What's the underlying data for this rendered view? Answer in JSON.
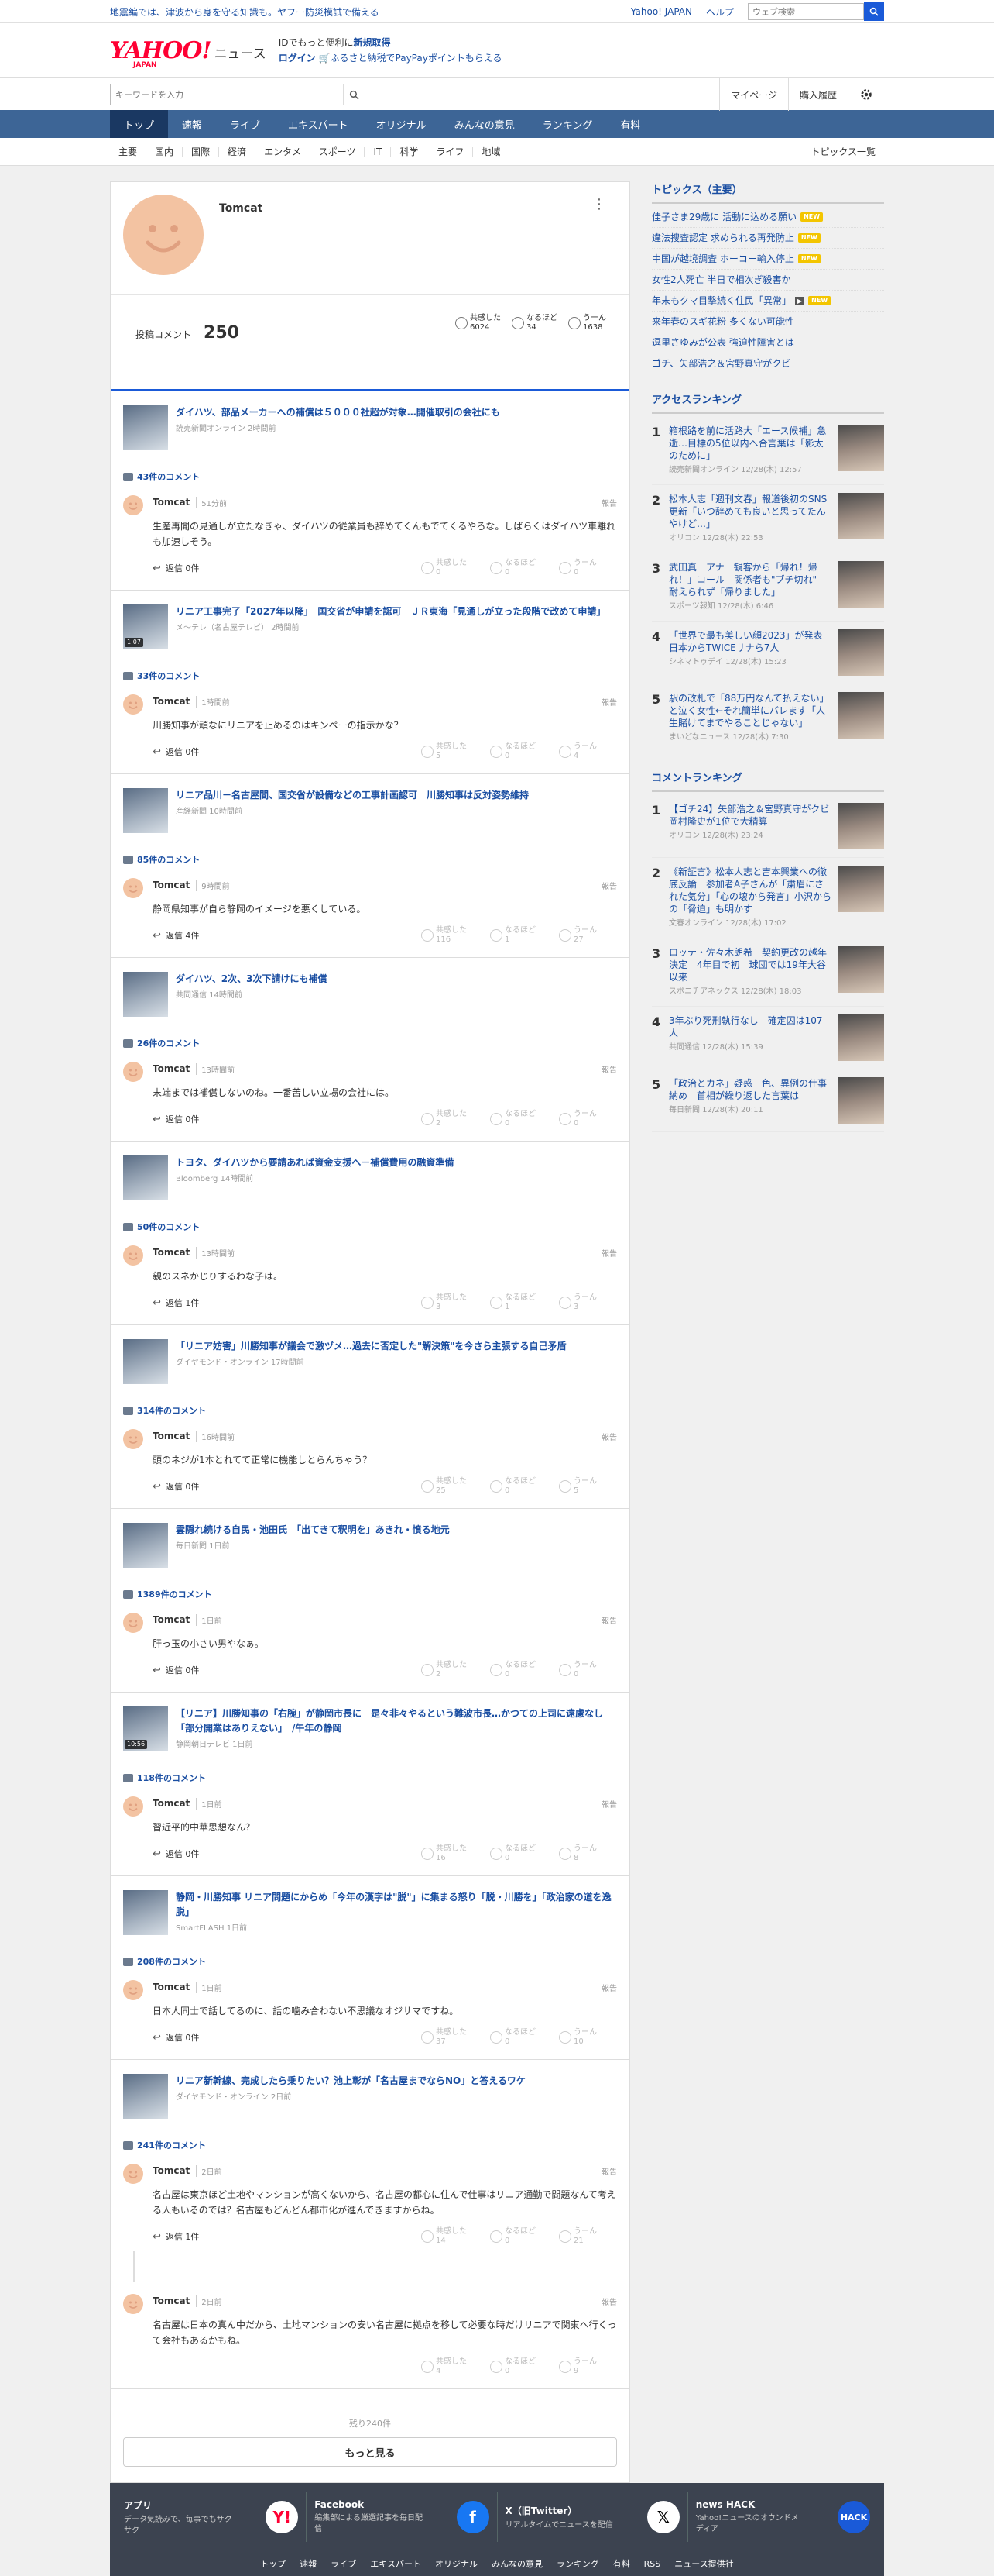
{
  "topbar": {
    "notice": "地震編では、津波から身を守る知識も。ヤフー防災模試で備える",
    "links": [
      "Yahoo! JAPAN",
      "ヘルプ"
    ],
    "search_placeholder": "ウェブ検索"
  },
  "header": {
    "logo": "YAHOO!",
    "logo_sub": "JAPAN",
    "logo_news": "ニュース",
    "line1_prefix": "IDでもっと便利に",
    "line1_link": "新規取得",
    "login": "ログイン",
    "line2": "ふるさと納税でPayPayポイントもらえる"
  },
  "searchbar": {
    "placeholder": "キーワードを入力",
    "mypage": "マイページ",
    "history": "購入履歴"
  },
  "nav": [
    "トップ",
    "速報",
    "ライブ",
    "エキスパート",
    "オリジナル",
    "みんなの意見",
    "ランキング",
    "有料"
  ],
  "subnav": [
    "主要",
    "国内",
    "国際",
    "経済",
    "エンタメ",
    "スポーツ",
    "IT",
    "科学",
    "ライフ",
    "地域"
  ],
  "subnav_more": "トピックス一覧",
  "profile": {
    "name": "Tomcat",
    "posts_label": "投稿コメント",
    "posts": "250",
    "stats": [
      {
        "label": "共感した",
        "value": "6024"
      },
      {
        "label": "なるほど",
        "value": "34"
      },
      {
        "label": "うーん",
        "value": "1638"
      }
    ]
  },
  "items": [
    {
      "title": "ダイハツ、部品メーカーへの補償は５０００社超が対象…開催取引の会社にも",
      "src": "読売新聞オンライン 2時間前",
      "count": "43件のコメント",
      "comments": [
        {
          "user": "Tomcat",
          "time": "51分前",
          "text": "生産再開の見通しが立たなきゃ、ダイハツの従業員も辞めてくんもでてくるやろな。しばらくはダイハツ車離れも加速しそう。",
          "reply": "返信 0件",
          "r": [
            "0",
            "0",
            "0"
          ]
        }
      ]
    },
    {
      "title": "リニア工事完了「2027年以降」　国交省が申請を認可　ＪＲ東海「見通しが立った段階で改めて申請」",
      "src": "メ〜テレ（名古屋テレビ） 2時間前",
      "video": "1:07",
      "count": "33件のコメント",
      "comments": [
        {
          "user": "Tomcat",
          "time": "1時間前",
          "text": "川勝知事が頑なにリニアを止めるのはキンペーの指示かな？",
          "reply": "返信 0件",
          "r": [
            "5",
            "0",
            "4"
          ]
        }
      ]
    },
    {
      "title": "リニア品川－名古屋間、国交省が設備などの工事計画認可　川勝知事は反対姿勢維持",
      "src": "産経新聞 10時間前",
      "count": "85件のコメント",
      "comments": [
        {
          "user": "Tomcat",
          "time": "9時間前",
          "text": "静岡県知事が自ら静岡のイメージを悪くしている。",
          "reply": "返信 4件",
          "r": [
            "116",
            "1",
            "27"
          ]
        }
      ]
    },
    {
      "title": "ダイハツ、2次、3次下請けにも補償",
      "src": "共同通信 14時間前",
      "count": "26件のコメント",
      "comments": [
        {
          "user": "Tomcat",
          "time": "13時間前",
          "text": "末端までは補償しないのね。一番苦しい立場の会社には。",
          "reply": "返信 0件",
          "r": [
            "2",
            "0",
            "0"
          ]
        }
      ]
    },
    {
      "title": "トヨタ、ダイハツから要請あれば資金支援へ－補償費用の融資準備",
      "src": "Bloomberg 14時間前",
      "count": "50件のコメント",
      "comments": [
        {
          "user": "Tomcat",
          "time": "13時間前",
          "text": "親のスネかじりするわな子は。",
          "reply": "返信 1件",
          "r": [
            "3",
            "1",
            "3"
          ]
        }
      ]
    },
    {
      "title": "「リニア妨害」川勝知事が議会で激ヅメ…過去に否定した\"解決策\"を今さら主張する自己矛盾",
      "src": "ダイヤモンド・オンライン 17時間前",
      "count": "314件のコメント",
      "comments": [
        {
          "user": "Tomcat",
          "time": "16時間前",
          "text": "頭のネジが1本とれてて正常に機能しとらんちゃう？",
          "reply": "返信 0件",
          "r": [
            "25",
            "0",
            "5"
          ]
        }
      ]
    },
    {
      "title": "雲隠れ続ける自民・池田氏　「出てきて釈明を」あきれ・憤る地元",
      "src": "毎日新聞 1日前",
      "count": "1389件のコメント",
      "comments": [
        {
          "user": "Tomcat",
          "time": "1日前",
          "text": "肝っ玉の小さい男やなぁ。",
          "reply": "返信 0件",
          "r": [
            "2",
            "0",
            "0"
          ]
        }
      ]
    },
    {
      "title": "【リニア】川勝知事の「右腕」が静岡市長に　是々非々やるという難波市長…かつての上司に遠慮なし「部分開業はありえない」　/午年の静岡",
      "src": "静岡朝日テレビ 1日前",
      "video": "10:56",
      "count": "118件のコメント",
      "comments": [
        {
          "user": "Tomcat",
          "time": "1日前",
          "text": "習近平的中華思想なん？",
          "reply": "返信 0件",
          "r": [
            "16",
            "0",
            "8"
          ]
        }
      ]
    },
    {
      "title": "静岡・川勝知事 リニア問題にからめ「今年の漢字は\"脱\"」に集まる怒り「脱・川勝を」「政治家の道を逸脱」",
      "src": "SmartFLASH 1日前",
      "count": "208件のコメント",
      "comments": [
        {
          "user": "Tomcat",
          "time": "1日前",
          "text": "日本人同士で話してるのに、話の噛み合わない不思議なオジサマですね。",
          "reply": "返信 0件",
          "r": [
            "37",
            "0",
            "10"
          ]
        }
      ]
    },
    {
      "title": "リニア新幹線、完成したら乗りたい？池上彰が「名古屋までならNO」と答えるワケ",
      "src": "ダイヤモンド・オンライン 2日前",
      "count": "241件のコメント",
      "comments": [
        {
          "user": "Tomcat",
          "time": "2日前",
          "text": "名古屋は東京ほど土地やマンションが高くないから、名古屋の都心に住んで仕事はリニア通勤で問題なんて考える人もいるのでは？名古屋もどんどん都市化が進んできますからね。",
          "reply": "返信 1件",
          "r": [
            "14",
            "0",
            "21"
          ]
        },
        {
          "user": "Tomcat",
          "time": "2日前",
          "text": "名古屋は日本の真ん中だから、土地マンションの安い名古屋に拠点を移して必要な時だけリニアで関東へ行くって会社もあるかもね。",
          "reply": "",
          "r": [
            "4",
            "0",
            "9"
          ]
        }
      ]
    }
  ],
  "reaction_labels": [
    "共感した",
    "なるほど",
    "うーん"
  ],
  "rest": "残り240件",
  "more_button": "もっと見る",
  "topics": {
    "title": "トピックス（主要）",
    "items": [
      {
        "t": "佳子さま29歳に 活動に込める願い",
        "new": true
      },
      {
        "t": "違法捜査認定 求められる再発防止",
        "new": true
      },
      {
        "t": "中国が越境調査 ホーコー輸入停止",
        "new": true
      },
      {
        "t": "女性2人死亡 半日で相次ぎ殺害か",
        "new": false
      },
      {
        "t": "年末もクマ目撃続く住民「異常」",
        "new": true,
        "video": "▶"
      },
      {
        "t": "来年春のスギ花粉 多くない可能性",
        "new": false
      },
      {
        "t": "逗里さゆみが公表 強迫性障害とは",
        "new": false
      },
      {
        "t": "ゴチ、矢部浩之＆宮野真守がクビ",
        "new": false
      }
    ]
  },
  "access": {
    "title": "アクセスランキング",
    "items": [
      {
        "n": "1",
        "t": "箱根路を前に活路大「エース候補」急逝…目標の5位以内へ合言葉は「影太のために」",
        "s": "読売新聞オンライン 12/28(木) 12:57"
      },
      {
        "n": "2",
        "t": "松本人志「週刊文春」報道後初のSNS更新「いつ辞めても良いと思ってたんやけど…」",
        "s": "オリコン 12/28(木) 22:53"
      },
      {
        "n": "3",
        "t": "武田真一アナ　観客から「帰れ！帰れ！」コール　関係者も\"ブチ切れ\"　耐えられず「帰りました」",
        "s": "スポーツ報知 12/28(木) 6:46"
      },
      {
        "n": "4",
        "t": "「世界で最も美しい顔2023」が発表　日本からTWICEサナら7人",
        "s": "シネマトゥデイ 12/28(木) 15:23"
      },
      {
        "n": "5",
        "t": "駅の改札で「88万円なんて払えない」と泣く女性←それ簡単にバレます「人生賭けてまでやることじゃない」",
        "s": "まいどなニュース 12/28(木) 7:30"
      }
    ]
  },
  "ranking": {
    "title": "コメントランキング",
    "items": [
      {
        "n": "1",
        "t": "【ゴチ24】矢部浩之＆宮野真守がクビ　岡村隆史が1位で大精算",
        "s": "オリコン 12/28(木) 23:24"
      },
      {
        "n": "2",
        "t": "《新証言》松本人志と吉本興業への徹底反論　参加者A子さんが「粛眉にされた気分」「心の壊から発言」小沢からの「脅迫」も明かす",
        "s": "文春オンライン 12/28(木) 17:02"
      },
      {
        "n": "3",
        "t": "ロッテ・佐々木朗希　契約更改の越年決定　4年目で初　球団では19年大谷以来",
        "s": "スポニチアネックス 12/28(木) 18:03"
      },
      {
        "n": "4",
        "t": "3年ぶり死刑執行なし　確定囚は107人",
        "s": "共同通信 12/28(木) 15:39"
      },
      {
        "n": "5",
        "t": "「政治とカネ」疑惑一色、異例の仕事納め　首相が繰り返した言葉は",
        "s": "毎日新聞 12/28(木) 20:11"
      }
    ]
  },
  "footer": {
    "cards": [
      {
        "t": "アプリ",
        "d": "データ気読みで、毎事でもサクサク",
        "i": "Y!"
      },
      {
        "t": "Facebook",
        "d": "編集部による厳選記事を毎日配信",
        "i": "f"
      },
      {
        "t": "X（旧Twitter）",
        "d": "リアルタイムでニュースを配信",
        "i": "𝕏"
      },
      {
        "t": "news HACK",
        "d": "Yahoo!ニュースのオウンドメディア",
        "i": "HACK"
      }
    ],
    "links": [
      "トップ",
      "速報",
      "ライブ",
      "エキスパート",
      "オリジナル",
      "みんなの意見",
      "ランキング",
      "有料",
      "RSS",
      "ニュース提供社"
    ]
  },
  "colors": {
    "accent": "#1a5ad8",
    "nav": "#3d6596",
    "nav_active": "#1a3862",
    "link": "#1a4ea2",
    "avatar": "#f3c3a2",
    "new_badge": "#f3c500",
    "footer": "#3c4350",
    "facebook": "#1877f2"
  }
}
